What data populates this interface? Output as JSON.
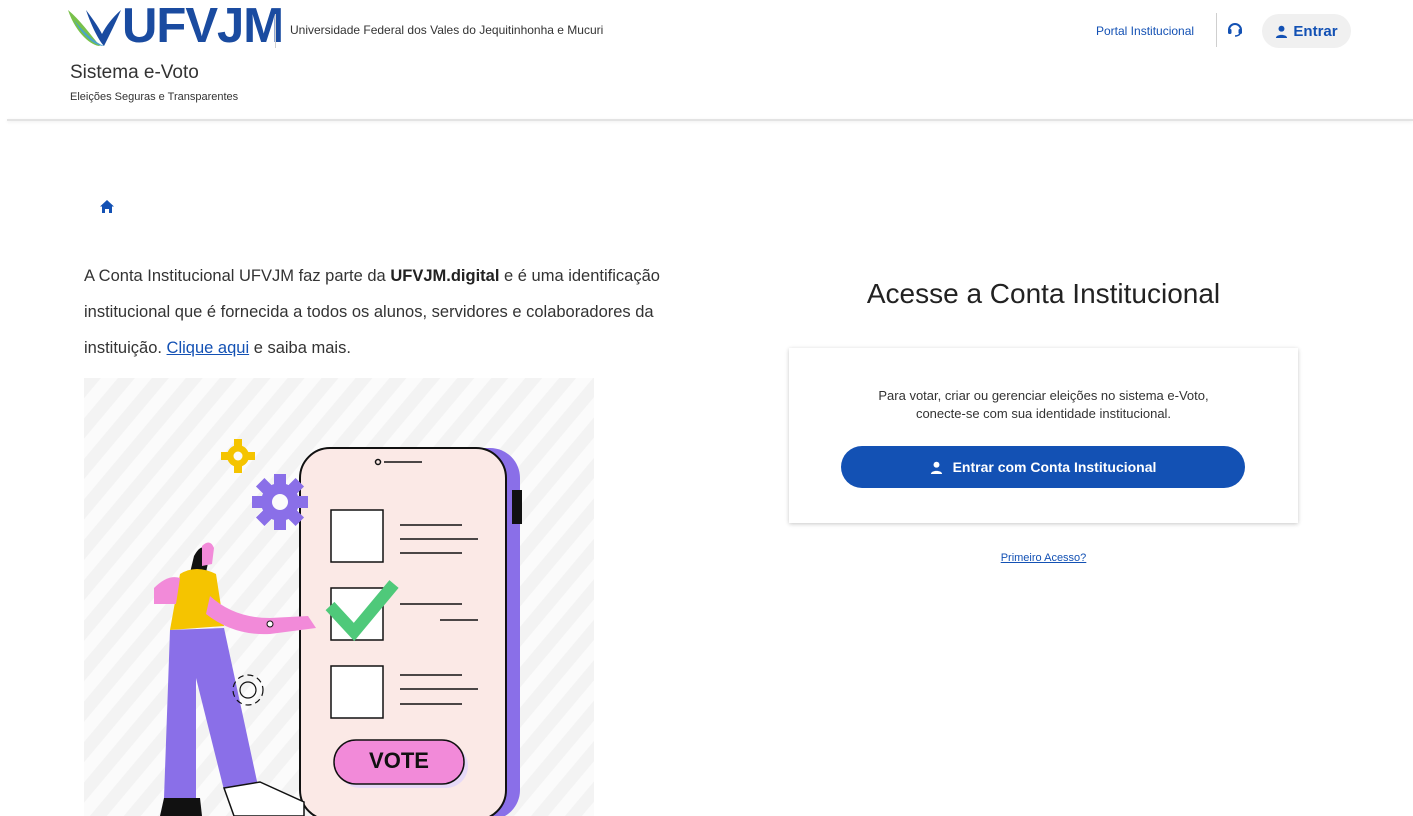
{
  "header": {
    "logo_text": "UFVJM",
    "university_name": "Universidade Federal dos Vales do Jequitinhonha e Mucuri",
    "system_title": "Sistema e-Voto",
    "system_subtitle": "Eleições Seguras e Transparentes",
    "portal_link": "Portal Institucional",
    "login_label": "Entrar",
    "help_icon": "headset-icon",
    "user_icon": "user-icon"
  },
  "breadcrumb": {
    "home_icon": "home-icon"
  },
  "intro": {
    "text_before": "A Conta Institucional UFVJM faz parte da ",
    "bold_text": "UFVJM.digital",
    "text_middle": " e é uma identificação institucional que é fornecida a todos os alunos, servidores e colaboradores da instituição. ",
    "link_text": "Clique aqui",
    "text_after": " e saiba mais."
  },
  "illustration": {
    "vote_label": "VOTE"
  },
  "access": {
    "title": "Acesse a Conta Institucional",
    "card_text_line1": "Para votar, criar ou gerenciar eleições no sistema e-Voto,",
    "card_text_line2": "conecte-se com sua identidade institucional.",
    "login_button": "Entrar com Conta Institucional",
    "first_access": "Primeiro Acesso?"
  },
  "colors": {
    "primary": "#1351b4",
    "logo_blue": "#1a4ba0",
    "logo_green": "#78c14a",
    "vote_pink": "#f28ad9",
    "purple": "#8a6fe8",
    "check_green": "#4fc97a",
    "yellow": "#f5c400"
  }
}
